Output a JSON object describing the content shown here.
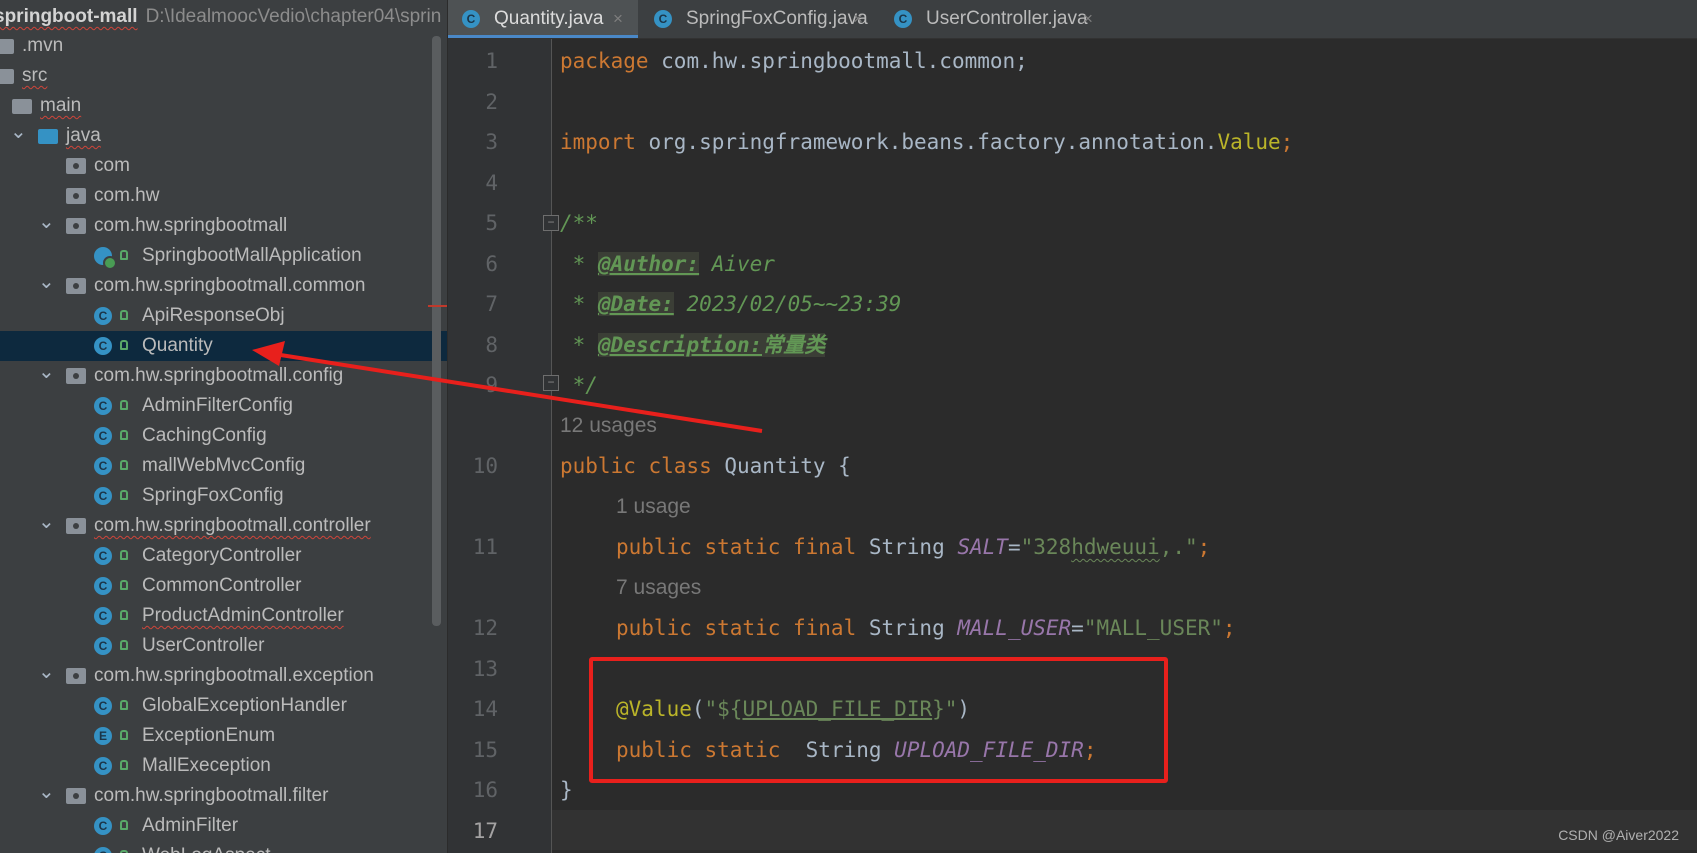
{
  "project": {
    "root_name": "springboot-mall",
    "root_path": "D:\\IdealmoocVedio\\chapter04\\sprin",
    "tree": [
      {
        "label": ".mvn",
        "indent": 0,
        "kind": "folder",
        "chevron": "",
        "lock": false,
        "selected": false,
        "wavy": false
      },
      {
        "label": "src",
        "indent": 0,
        "kind": "folder",
        "chevron": "",
        "lock": false,
        "selected": false,
        "wavy": true
      },
      {
        "label": "main",
        "indent": 1,
        "kind": "folder",
        "chevron": "",
        "lock": false,
        "selected": false,
        "wavy": true
      },
      {
        "label": "java",
        "indent": 2,
        "kind": "folder-java",
        "chevron": "expanded",
        "lock": false,
        "selected": false,
        "wavy": true
      },
      {
        "label": "com",
        "indent": 3,
        "kind": "package",
        "chevron": "",
        "lock": false,
        "selected": false,
        "wavy": false
      },
      {
        "label": "com.hw",
        "indent": 3,
        "kind": "package",
        "chevron": "",
        "lock": false,
        "selected": false,
        "wavy": false
      },
      {
        "label": "com.hw.springbootmall",
        "indent": 3,
        "kind": "package",
        "chevron": "expanded",
        "lock": false,
        "selected": false,
        "wavy": false
      },
      {
        "label": "SpringbootMallApplication",
        "indent": 4,
        "kind": "app",
        "chevron": "",
        "lock": true,
        "selected": false,
        "wavy": false
      },
      {
        "label": "com.hw.springbootmall.common",
        "indent": 3,
        "kind": "package",
        "chevron": "expanded",
        "lock": false,
        "selected": false,
        "wavy": false
      },
      {
        "label": "ApiResponseObj",
        "indent": 4,
        "kind": "class",
        "chevron": "",
        "lock": true,
        "selected": false,
        "wavy": false
      },
      {
        "label": "Quantity",
        "indent": 4,
        "kind": "class",
        "chevron": "",
        "lock": true,
        "selected": true,
        "wavy": false
      },
      {
        "label": "com.hw.springbootmall.config",
        "indent": 3,
        "kind": "package",
        "chevron": "expanded",
        "lock": false,
        "selected": false,
        "wavy": false
      },
      {
        "label": "AdminFilterConfig",
        "indent": 4,
        "kind": "class",
        "chevron": "",
        "lock": true,
        "selected": false,
        "wavy": false
      },
      {
        "label": "CachingConfig",
        "indent": 4,
        "kind": "class",
        "chevron": "",
        "lock": true,
        "selected": false,
        "wavy": false
      },
      {
        "label": "mallWebMvcConfig",
        "indent": 4,
        "kind": "class",
        "chevron": "",
        "lock": true,
        "selected": false,
        "wavy": false
      },
      {
        "label": "SpringFoxConfig",
        "indent": 4,
        "kind": "class",
        "chevron": "",
        "lock": true,
        "selected": false,
        "wavy": false
      },
      {
        "label": "com.hw.springbootmall.controller",
        "indent": 3,
        "kind": "package",
        "chevron": "expanded",
        "lock": false,
        "selected": false,
        "wavy": true
      },
      {
        "label": "CategoryController",
        "indent": 4,
        "kind": "class",
        "chevron": "",
        "lock": true,
        "selected": false,
        "wavy": false
      },
      {
        "label": "CommonController",
        "indent": 4,
        "kind": "class",
        "chevron": "",
        "lock": true,
        "selected": false,
        "wavy": false
      },
      {
        "label": "ProductAdminController",
        "indent": 4,
        "kind": "class",
        "chevron": "",
        "lock": true,
        "selected": false,
        "wavy": true
      },
      {
        "label": "UserController",
        "indent": 4,
        "kind": "class",
        "chevron": "",
        "lock": true,
        "selected": false,
        "wavy": false
      },
      {
        "label": "com.hw.springbootmall.exception",
        "indent": 3,
        "kind": "package",
        "chevron": "expanded",
        "lock": false,
        "selected": false,
        "wavy": false
      },
      {
        "label": "GlobalExceptionHandler",
        "indent": 4,
        "kind": "class",
        "chevron": "",
        "lock": true,
        "selected": false,
        "wavy": false
      },
      {
        "label": "ExceptionEnum",
        "indent": 4,
        "kind": "enum",
        "chevron": "",
        "lock": true,
        "selected": false,
        "wavy": false
      },
      {
        "label": "MallExeception",
        "indent": 4,
        "kind": "class",
        "chevron": "",
        "lock": true,
        "selected": false,
        "wavy": false
      },
      {
        "label": "com.hw.springbootmall.filter",
        "indent": 3,
        "kind": "package",
        "chevron": "expanded",
        "lock": false,
        "selected": false,
        "wavy": false
      },
      {
        "label": "AdminFilter",
        "indent": 4,
        "kind": "class",
        "chevron": "",
        "lock": true,
        "selected": false,
        "wavy": false
      },
      {
        "label": "WebLogAspect",
        "indent": 4,
        "kind": "class",
        "chevron": "",
        "lock": true,
        "selected": false,
        "wavy": false
      }
    ]
  },
  "tabs": [
    {
      "label": "Quantity.java",
      "active": true,
      "icon": "class-icon",
      "close": "×"
    },
    {
      "label": "SpringFoxConfig.java",
      "active": false,
      "icon": "class-icon",
      "close": "×"
    },
    {
      "label": "UserController.java",
      "active": false,
      "icon": "class-icon",
      "close": "×"
    }
  ],
  "editor": {
    "line_numbers": [
      "1",
      "2",
      "3",
      "4",
      "5",
      "6",
      "7",
      "8",
      "9",
      "10",
      "11",
      "12",
      "13",
      "14",
      "15",
      "16",
      "17"
    ],
    "usage_hints": [
      "12 usages",
      "1 usage",
      "7 usages"
    ],
    "code": {
      "l1_kw": "package",
      "l1_rest": " com.hw.springbootmall.common;",
      "l3_kw": "import",
      "l3_pkg": " org.springframework.beans.factory.annotation.",
      "l3_ann": "Value",
      "l3_semi": ";",
      "l5": "/**",
      "l6_star": " * ",
      "l6_tag": "@Author:",
      "l6_val": " Aiver",
      "l7_star": " * ",
      "l7_tag": "@Date:",
      "l7_val": " 2023/02/05~~23:39",
      "l8_star": " * ",
      "l8_tag": "@Description:",
      "l8_val": "常量类",
      "l9": " */",
      "l10_kw": "public class",
      "l10_rest": " Quantity {",
      "l11_kw": "public static final",
      "l11_type": " String ",
      "l11_field": "SALT",
      "l11_eq": "=",
      "l11_str_a": "\"328",
      "l11_str_b": "hdweuui",
      "l11_str_c": ",.\"",
      "l11_semi": ";",
      "l12_kw": "public static final",
      "l12_type": " String ",
      "l12_field": "MALL_USER",
      "l12_eq": "=",
      "l12_str": "\"MALL_USER\"",
      "l12_semi": ";",
      "l14_ann": "@Value",
      "l14_p1": "(",
      "l14_str_a": "\"${",
      "l14_str_b": "UPLOAD_FILE_DIR",
      "l14_str_c": "}\"",
      "l14_p2": ")",
      "l15_kw": "public static",
      "l15_type": "  String ",
      "l15_field": "UPLOAD_FILE_DIR",
      "l15_semi": ";",
      "l16": "}"
    }
  },
  "watermark": "CSDN @Aiver2022",
  "colors": {
    "keyword": "#cc7832",
    "string": "#6a8759",
    "annotation": "#bbb529",
    "field": "#9876aa",
    "doc": "#629755",
    "highlight_box": "#e8201c",
    "selection": "#0d293e"
  }
}
